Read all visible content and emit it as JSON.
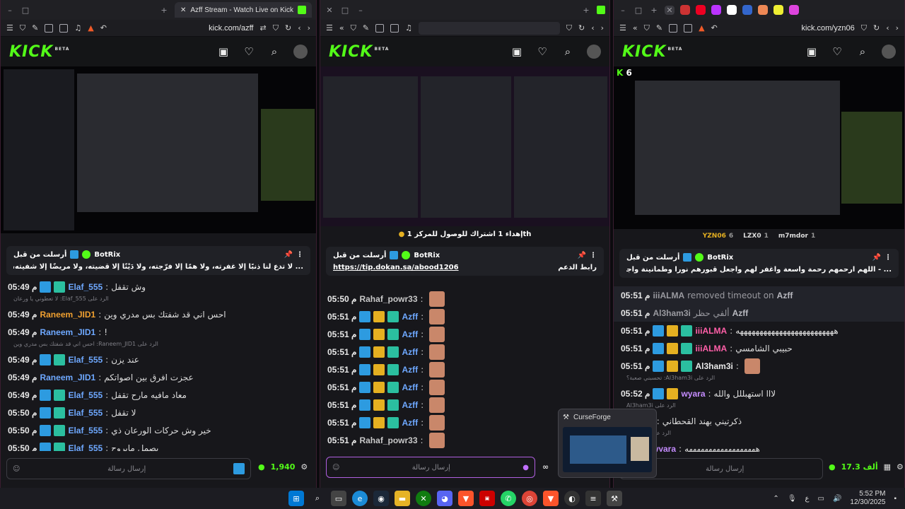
{
  "windows": [
    {
      "tab_title": "Azff Stream - Watch Live on Kick",
      "url": "kick.com/azff",
      "logo": "KICK",
      "logo_sup": "BETA",
      "pinned": {
        "by": "BotRix",
        "header": "أرسلت من قبل",
        "body": "... لا تدع لنا ذنبًا إلا غفرته، ولا همًا إلا فرّجته، ولا دَيْنًا إلا قضيته، ولا مريضًا إلا شفيته، ولا ميتًا إلا عافيته، ولا مبتلى إلا عافيته يا أكرم الأكرمين"
      },
      "messages": [
        {
          "time": "05:49 م",
          "name": "Elaf_555",
          "text": "وش تقفل",
          "color": "#6ea8ff",
          "badges": [
            "b1",
            "b3"
          ]
        },
        {
          "reply": "الرد على Elaf_555: لا تعطوني يا ورعان"
        },
        {
          "time": "05:49 م",
          "name": "Raneem_JID1",
          "text": "احس اني قد شفتك بس مدري وين",
          "color": "#f0a030",
          "badges": []
        },
        {
          "time": "05:49 م",
          "name": "Raneem_JID1",
          "text": "!",
          "color": "#6ea8ff",
          "badges": []
        },
        {
          "reply": "الرد على Raneem_JID1: احس اني قد شفتك بس مدري وين"
        },
        {
          "time": "05:49 م",
          "name": "Elaf_555",
          "text": "عند يزن",
          "color": "#6ea8ff",
          "badges": [
            "b1",
            "b3"
          ]
        },
        {
          "time": "05:49 م",
          "name": "Raneem_JID1",
          "text": "عجزت افرق بين اصواتكم",
          "color": "#6ea8ff",
          "badges": []
        },
        {
          "time": "05:49 م",
          "name": "Elaf_555",
          "text": "معاد مافيه مارح تقفل",
          "color": "#6ea8ff",
          "badges": [
            "b1",
            "b3"
          ]
        },
        {
          "time": "05:50 م",
          "name": "Elaf_555",
          "text": "لا تقفل",
          "color": "#6ea8ff",
          "badges": [
            "b1",
            "b3"
          ]
        },
        {
          "time": "05:50 م",
          "name": "Elaf_555",
          "text": "خير وش حركات الورعان ذي",
          "color": "#6ea8ff",
          "badges": [
            "b1",
            "b3"
          ]
        },
        {
          "time": "05:50 م",
          "name": "Elaf_555",
          "text": "بصمل مابروح",
          "color": "#6ea8ff",
          "badges": [
            "b1",
            "b3"
          ]
        }
      ],
      "composer_placeholder": "إرسال رسالة",
      "points": "1,940"
    },
    {
      "url": "",
      "logo": "KICK",
      "logo_sup": "BETA",
      "goal": "إهداء 1 اشتراك للوصول للمركز 1",
      "goal_suffix": "th",
      "pinned": {
        "by": "BotRix",
        "header": "أرسلت من قبل",
        "link": "https://tip.dokan.sa/abood1206",
        "link_label": "رابط الدعم"
      },
      "messages": [
        {
          "time": "05:50 م",
          "name": "Rahaf_powr33",
          "text": "",
          "color": "#c8c8c8",
          "badges": []
        },
        {
          "time": "05:51 م",
          "name": "Azff",
          "text": "",
          "color": "#6ea8ff",
          "badges": [
            "b1",
            "b2",
            "b3"
          ]
        },
        {
          "time": "05:51 م",
          "name": "Azff",
          "text": "",
          "color": "#6ea8ff",
          "badges": [
            "b1",
            "b2",
            "b3"
          ]
        },
        {
          "time": "05:51 م",
          "name": "Azff",
          "text": "",
          "color": "#6ea8ff",
          "badges": [
            "b1",
            "b2",
            "b3"
          ]
        },
        {
          "time": "05:51 م",
          "name": "Azff",
          "text": "",
          "color": "#6ea8ff",
          "badges": [
            "b1",
            "b2",
            "b3"
          ]
        },
        {
          "time": "05:51 م",
          "name": "Azff",
          "text": "",
          "color": "#6ea8ff",
          "badges": [
            "b1",
            "b2",
            "b3"
          ]
        },
        {
          "time": "05:51 م",
          "name": "Azff",
          "text": "",
          "color": "#6ea8ff",
          "badges": [
            "b1",
            "b2",
            "b3"
          ]
        },
        {
          "time": "05:51 م",
          "name": "Azff",
          "text": "",
          "color": "#6ea8ff",
          "badges": [
            "b1",
            "b2",
            "b3"
          ]
        },
        {
          "time": "05:51 م",
          "name": "Rahaf_powr33",
          "text": "",
          "color": "#c8c8c8",
          "badges": []
        }
      ],
      "composer_placeholder": "إرسال رسالة"
    },
    {
      "url": "kick.com/yzn06",
      "logo": "KICK",
      "logo_sup": "BETA",
      "viewer_count": "6",
      "top_viewers": [
        {
          "name": "YZN06",
          "count": "6"
        },
        {
          "name": "LZX0",
          "count": "1"
        },
        {
          "name": "m7mdor",
          "count": "1"
        }
      ],
      "pinned": {
        "by": "BotRix",
        "header": "أرسلت من قبل",
        "body": "... - اللهم ارحمهم رحمة واسعة واغفر لهم واجعل قبورهم نورا وطمأنينة واجمعنا بهم في جنتك بلا حساب ولا عقاب"
      },
      "messages": [
        {
          "time": "05:51 م",
          "name": "iiiALMA",
          "text": "removed timeout on",
          "extra": "Azff",
          "color": "#9a9aa0",
          "badges": [],
          "system": true
        },
        {
          "time": "05:51 م",
          "name": "Al3ham3i",
          "text": "ألفي حظر",
          "extra": "Azff",
          "color": "#9a9aa0",
          "badges": [],
          "system": true
        },
        {
          "time": "05:51 م",
          "name": "iiiALMA",
          "text": "هههههههههههههههههههههههههه",
          "color": "#ff5fa8",
          "badges": [
            "b1",
            "b2",
            "b3"
          ]
        },
        {
          "time": "05:51 م",
          "name": "iiiALMA",
          "text": "حبيبي الشامسي",
          "color": "#ff5fa8",
          "badges": [
            "b1",
            "b2",
            "b3"
          ]
        },
        {
          "time": "05:51 م",
          "name": "Al3ham3i",
          "text": "",
          "color": "#e8e8e8",
          "badges": [
            "b1",
            "b2",
            "b3"
          ]
        },
        {
          "reply": "الرد على Al3ham3i: تحسبني صعبة؟"
        },
        {
          "time": "05:52 م",
          "name": "wyara",
          "text": "لااا استهبللل والله",
          "color": "#c58cff",
          "badges": [
            "b1",
            "b2"
          ]
        },
        {
          "reply": "الرد على Al3ham3i"
        },
        {
          "time": "",
          "name": "roree11",
          "text": "ذكرتيني بهند القحطاني",
          "color": "#c58cff",
          "badges": []
        },
        {
          "reply": "الرد على roree11"
        },
        {
          "time": "",
          "name": "wyara",
          "text": "ههههههههههههههههههه",
          "color": "#c58cff",
          "badges": [
            "b2",
            "b3"
          ]
        }
      ],
      "composer_placeholder": "إرسال رسالة",
      "points": "17.3 ألف"
    }
  ],
  "popup": {
    "title": "CurseForge"
  },
  "taskbar": {
    "apps": [
      "start",
      "search",
      "taskview",
      "edge",
      "steam",
      "files",
      "xbox",
      "discord",
      "brave",
      "news",
      "whatsapp",
      "chrome",
      "brave2",
      "obs",
      "terminal",
      "curseforge"
    ],
    "lang": "ع",
    "time": "5:52 PM",
    "date": "12/30/2025"
  }
}
